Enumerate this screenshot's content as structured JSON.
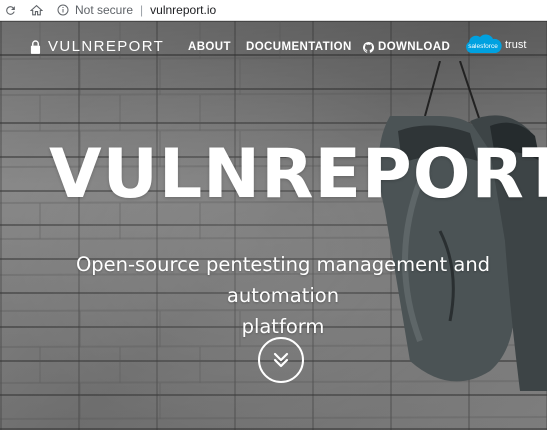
{
  "browser": {
    "security_label": "Not secure",
    "url": "vulnreport.io"
  },
  "nav": {
    "brand": "VULNREPORT",
    "items": [
      {
        "label": "ABOUT"
      },
      {
        "label": "DOCUMENTATION"
      },
      {
        "label": "DOWNLOAD"
      }
    ],
    "salesforce_logo_text": "salesforce",
    "salesforce_trust": "trust"
  },
  "hero": {
    "title": "VULNREPORT",
    "subtitle_line1": "Open-source pentesting management and automation",
    "subtitle_line2": "platform"
  },
  "colors": {
    "salesforce_blue": "#00A1E0",
    "text": "#ffffff"
  },
  "icons": [
    "reload-icon",
    "home-icon",
    "info-icon",
    "lock-icon",
    "github-icon",
    "chevron-double-down-icon"
  ]
}
